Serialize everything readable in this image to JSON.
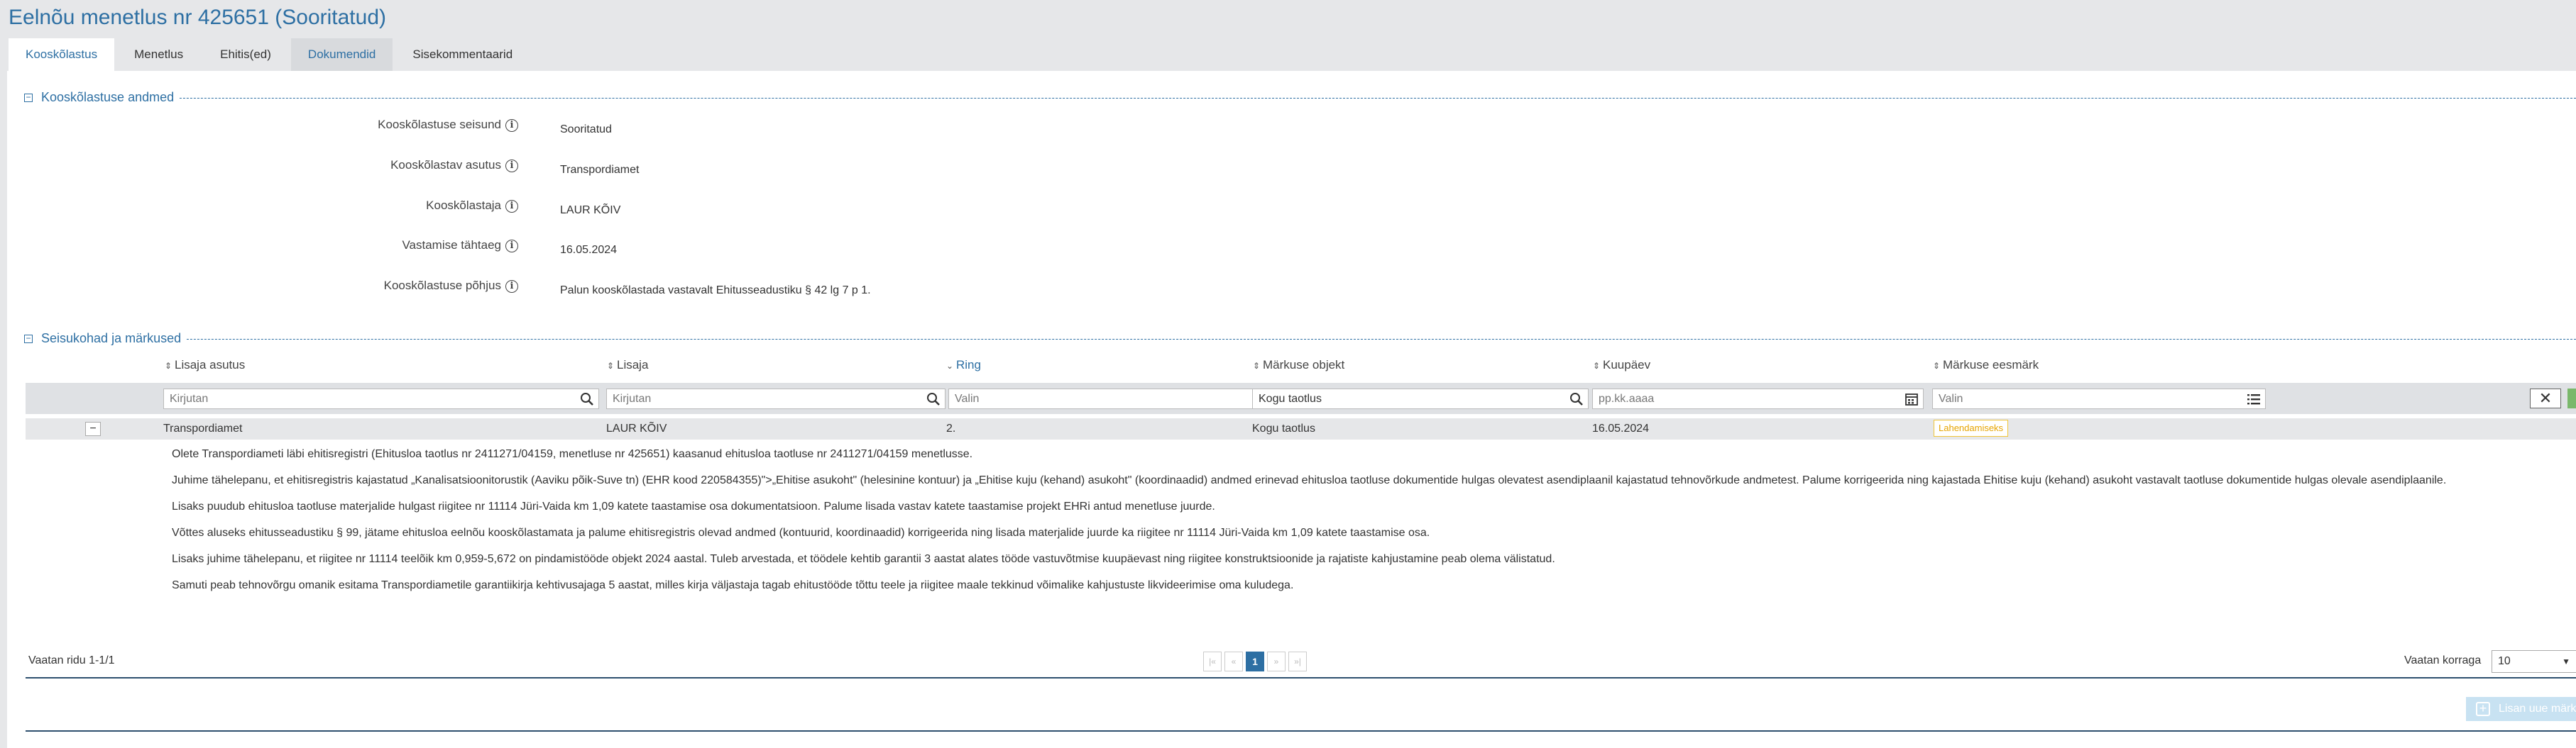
{
  "page": {
    "title": "Eelnõu menetlus nr 425651 (Sooritatud)"
  },
  "tabs": [
    {
      "label": "Kooskõlastus"
    },
    {
      "label": "Menetlus"
    },
    {
      "label": "Ehitis(ed)"
    },
    {
      "label": "Dokumendid"
    },
    {
      "label": "Sisekommentaarid"
    }
  ],
  "section1": {
    "title": "Kooskõlastuse andmed",
    "toggle": "−",
    "fields": [
      {
        "label": "Kooskõlastuse seisund",
        "value": "Sooritatud"
      },
      {
        "label": "Kooskõlastav asutus",
        "value": "Transpordiamet"
      },
      {
        "label": "Kooskõlastaja",
        "value": "LAUR KÕIV"
      },
      {
        "label": "Vastamise tähtaeg",
        "value": "16.05.2024"
      },
      {
        "label": "Kooskõlastuse põhjus",
        "value": "Palun kooskõlastada vastavalt Ehitusseadustiku § 42 lg 7 p 1."
      }
    ]
  },
  "section2": {
    "title": "Seisukohad ja märkused",
    "toggle": "−"
  },
  "table": {
    "columns": [
      {
        "label": "Lisaja asutus"
      },
      {
        "label": "Lisaja"
      },
      {
        "label": "Ring"
      },
      {
        "label": "Märkuse objekt"
      },
      {
        "label": "Kuupäev"
      },
      {
        "label": "Märkuse eesmärk"
      }
    ],
    "filters": {
      "asutus_placeholder": "Kirjutan",
      "lisaja_placeholder": "Kirjutan",
      "ring_placeholder": "Valin",
      "objekt_value": "Kogu taotlus",
      "kuupaev_placeholder": "pp.kk.aaaa",
      "eesmark_placeholder": "Valin",
      "clear": "✕"
    },
    "row": {
      "expander": "−",
      "asutus": "Transpordiamet",
      "lisaja": "LAUR KÕIV",
      "ring": "2.",
      "objekt": "Kogu taotlus",
      "kuupaev": "16.05.2024",
      "eesmark": "Lahendamiseks"
    },
    "details": [
      "Olete Transpordiameti läbi ehitisregistri (Ehitusloa taotlus nr 2411271/04159, menetluse nr 425651) kaasanud ehitusloa taotluse nr 2411271/04159 menetlusse.",
      "Juhime tähelepanu, et ehitisregistris kajastatud „Kanalisatsioonitorustik (Aaviku põik-Suve tn) (EHR kood 220584355)\">„Ehitise asukoht\" (helesinine kontuur) ja „Ehitise kuju (kehand) asukoht\" (koordinaadid) andmed erinevad ehitusloa taotluse dokumentide hulgas olevatest asendiplaanil kajastatud tehnovõrkude andmetest. Palume korrigeerida ning kajastada Ehitise kuju (kehand) asukoht vastavalt taotluse dokumentide hulgas olevale asendiplaanile.",
      "Lisaks puudub ehitusloa taotluse materjalide hulgast riigitee nr 11114 Jüri-Vaida km 1,09 katete taastamise osa dokumentatsioon. Palume lisada vastav katete taastamise projekt EHRi antud menetluse juurde.",
      "Võttes aluseks ehitusseadustiku § 99, jätame ehitusloa eelnõu kooskõlastamata ja palume ehitisregistris olevad andmed (kontuurid, koordinaadid) korrigeerida ning lisada materjalide juurde ka riigitee nr 11114 Jüri-Vaida km 1,09 katete taastamise osa.",
      "Lisaks juhime tähelepanu, et riigitee nr 11114 teelõik km 0,959-5,672 on pindamistööde objekt 2024 aastal. Tuleb arvestada, et töödele kehtib garantii 3 aastat alates tööde vastuvõtmise kuupäevast ning riigitee konstruktsioonide ja rajatiste kahjustamine peab olema välistatud.",
      "Samuti peab tehnovõrgu omanik esitama Transpordiametile garantiikirja kehtivusajaga 5 aastat, milles kirja väljastaja tagab ehitustööde tõttu teele ja riigitee maale tekkinud võimalike kahjustuste likvideerimise oma kuludega."
    ]
  },
  "pager": {
    "info": "Vaatan ridu 1-1/1",
    "first": "|«",
    "prev": "«",
    "current": "1",
    "next": "»",
    "last": "»|",
    "per_page_label": "Vaatan korraga",
    "per_page_value": "10"
  },
  "add_button": {
    "label": "Lisan uue märkuse",
    "icon": "plus-icon"
  },
  "colors": {
    "accent": "#2d6fa3",
    "badge": "#f0c53a",
    "header_bg": "#e6e7e9"
  }
}
